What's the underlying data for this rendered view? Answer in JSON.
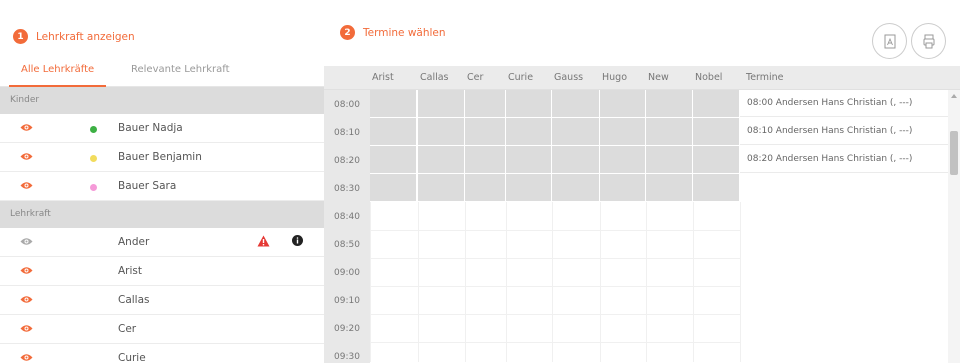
{
  "left": {
    "step1": {
      "num": "1",
      "label": "Lehrkraft anzeigen"
    },
    "tabs": [
      {
        "label": "Alle Lehrkräfte"
      },
      {
        "label": "Relevante Lehrkraft"
      }
    ],
    "sections": [
      {
        "title": "Kinder"
      },
      {
        "title": "Lehrkraft"
      }
    ],
    "kinder": [
      {
        "name": "Bauer Nadja",
        "dot_color": "#3db044",
        "eye_color": "#f26b3a"
      },
      {
        "name": "Bauer Benjamin",
        "dot_color": "#f2dc5d",
        "eye_color": "#f26b3a"
      },
      {
        "name": "Bauer Sara",
        "dot_color": "#f59ad8",
        "eye_color": "#f26b3a"
      }
    ],
    "lehrkraft": [
      {
        "name": "Ander",
        "eye_color": "#aaaaaa",
        "warn_icon": "warning-icon",
        "info_icon": "info-icon"
      },
      {
        "name": "Arist",
        "eye_color": "#f26b3a"
      },
      {
        "name": "Callas",
        "eye_color": "#f26b3a"
      },
      {
        "name": "Cer",
        "eye_color": "#f26b3a"
      },
      {
        "name": "Curie",
        "eye_color": "#f26b3a"
      }
    ]
  },
  "right": {
    "step2": {
      "num": "2",
      "label": "Termine wählen"
    },
    "toolbar": {
      "pdf_icon": "pdf-icon",
      "print_icon": "print-icon"
    },
    "columns": [
      "Arist",
      "Callas",
      "Cer",
      "Curie",
      "Gauss",
      "Hugo",
      "New",
      "Nobel"
    ],
    "termine_label": "Termine",
    "times": [
      "08:00",
      "08:10",
      "08:20",
      "08:30",
      "08:40",
      "08:50",
      "09:00",
      "09:10",
      "09:20",
      "09:30"
    ],
    "termine": [
      "08:00 Andersen Hans Christian (, ---)",
      "08:10 Andersen Hans Christian (, ---)",
      "08:20 Andersen Hans Christian (, ---)"
    ]
  },
  "colors": {
    "accent": "#f26b3a"
  }
}
